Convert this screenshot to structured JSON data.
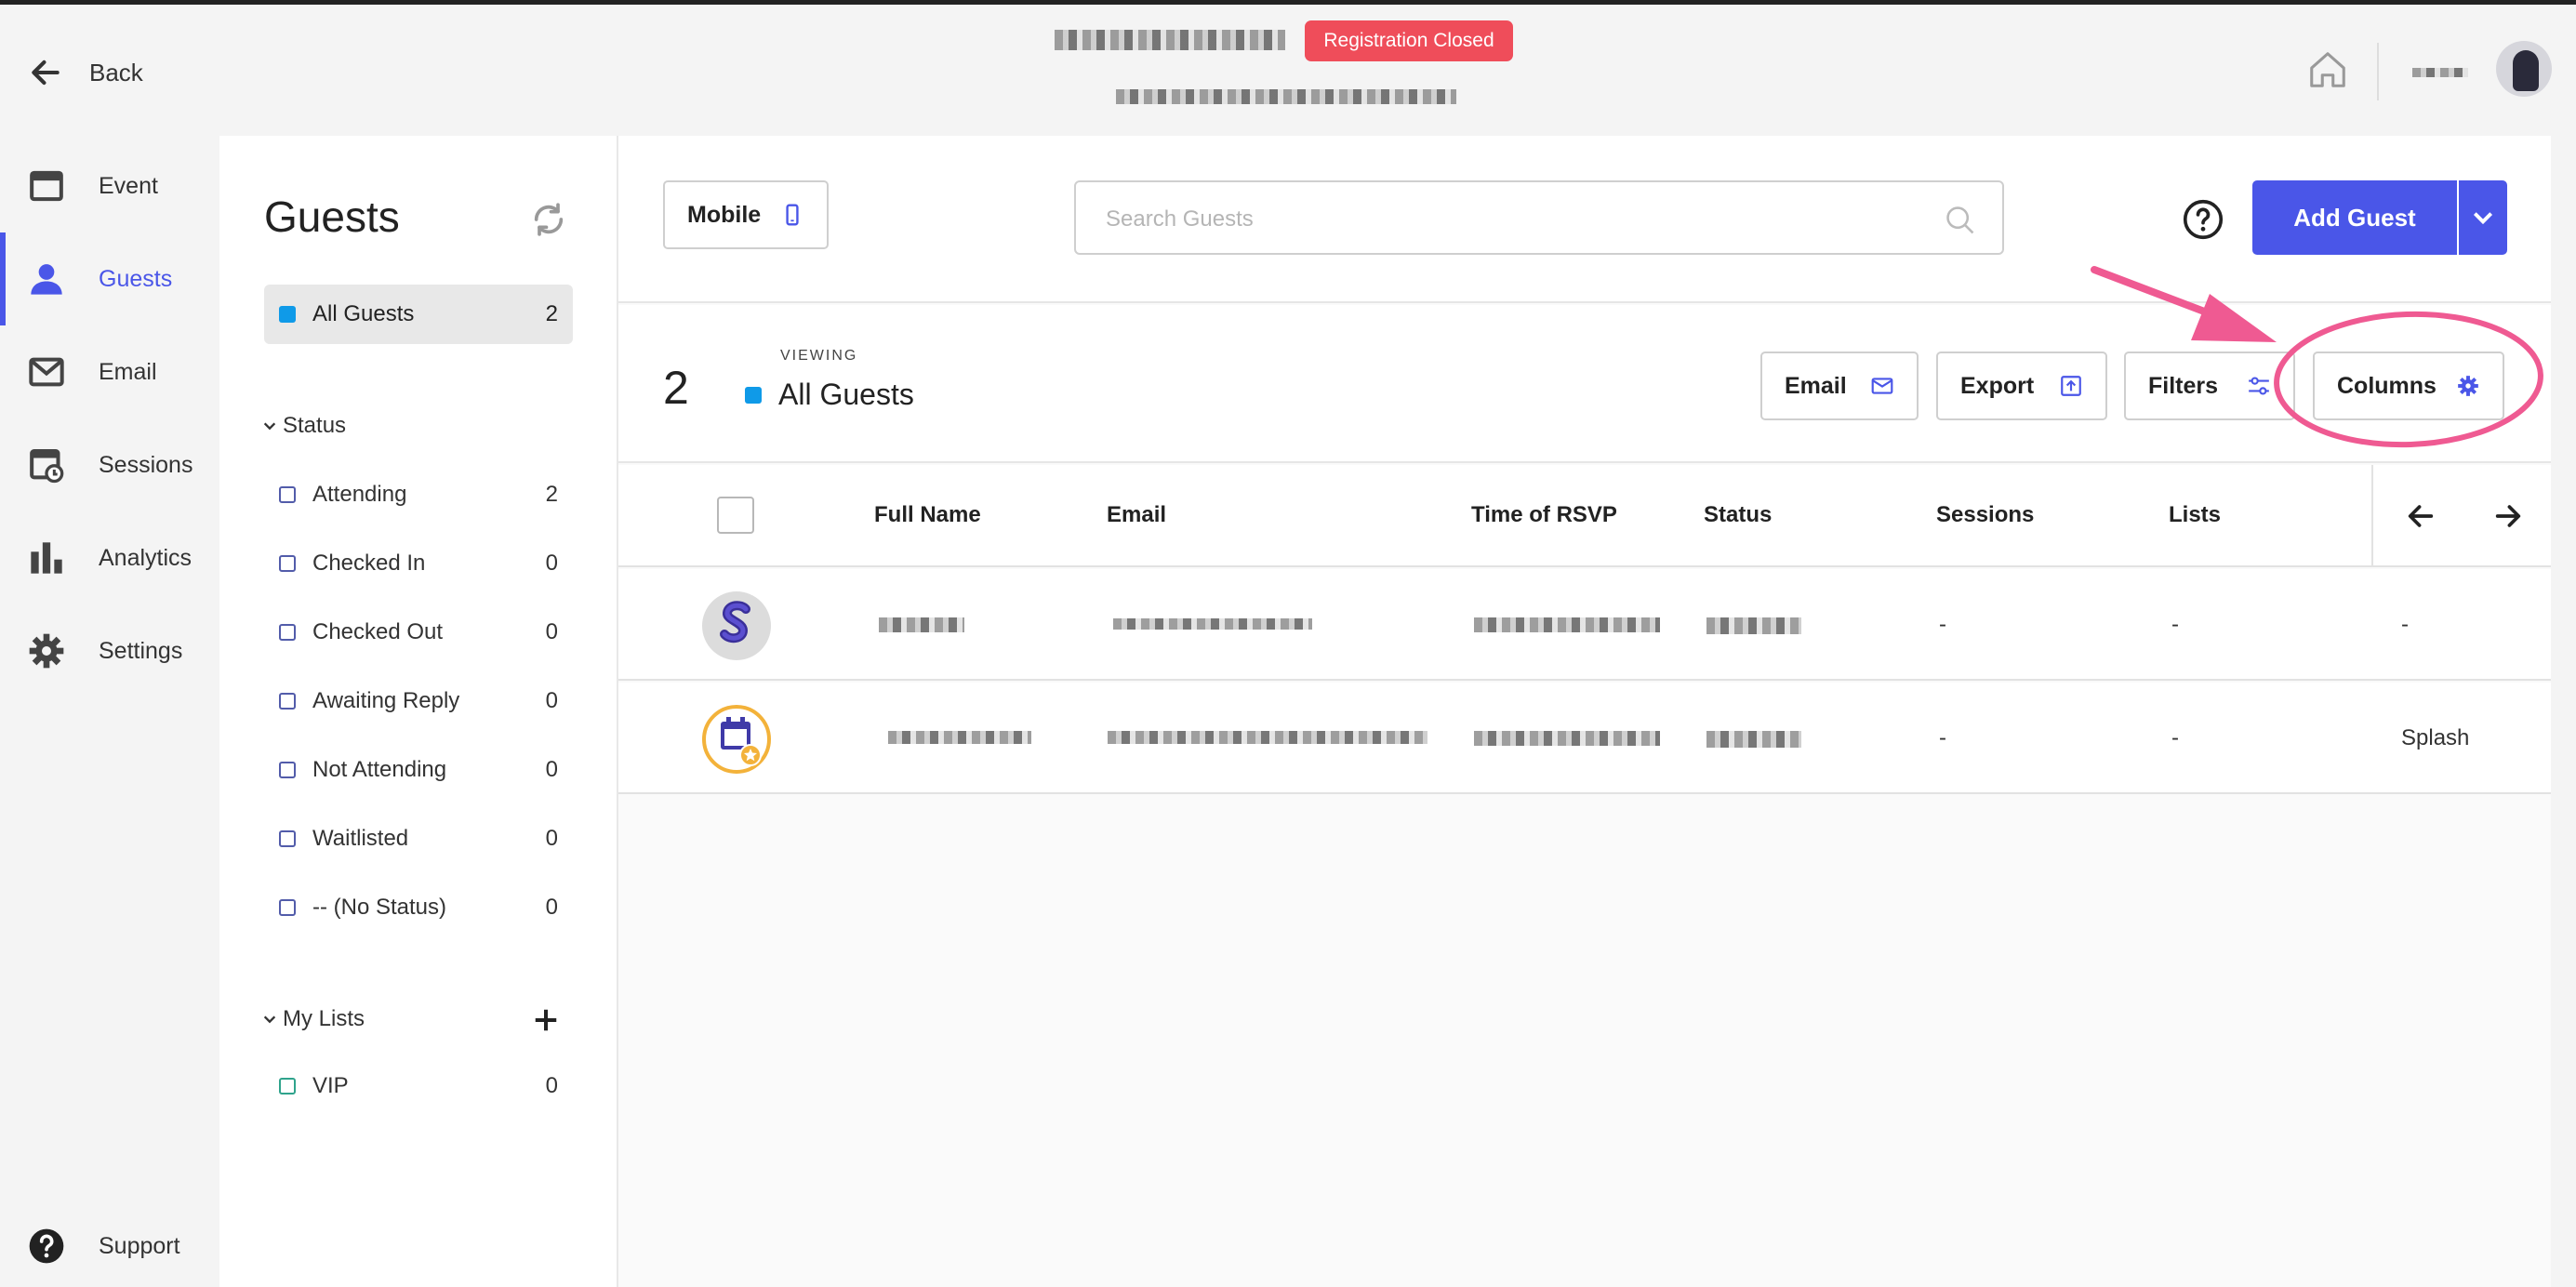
{
  "header": {
    "back_label": "Back",
    "badge": "Registration Closed"
  },
  "nav": {
    "items": [
      {
        "label": "Event",
        "icon": "calendar-icon"
      },
      {
        "label": "Guests",
        "icon": "person-icon"
      },
      {
        "label": "Email",
        "icon": "mail-icon"
      },
      {
        "label": "Sessions",
        "icon": "sessions-icon"
      },
      {
        "label": "Analytics",
        "icon": "bar-chart-icon"
      },
      {
        "label": "Settings",
        "icon": "gear-icon"
      }
    ],
    "active": "Guests",
    "support_label": "Support"
  },
  "guests_panel": {
    "title": "Guests",
    "all_guests": {
      "label": "All Guests",
      "count": "2"
    },
    "status_header": "Status",
    "statuses": [
      {
        "label": "Attending",
        "count": "2"
      },
      {
        "label": "Checked In",
        "count": "0"
      },
      {
        "label": "Checked Out",
        "count": "0"
      },
      {
        "label": "Awaiting Reply",
        "count": "0"
      },
      {
        "label": "Not Attending",
        "count": "0"
      },
      {
        "label": "Waitlisted",
        "count": "0"
      },
      {
        "label": "-- (No Status)",
        "count": "0"
      }
    ],
    "lists_header": "My Lists",
    "lists": [
      {
        "label": "VIP",
        "count": "0"
      }
    ]
  },
  "toolbar": {
    "mobile_label": "Mobile",
    "search_placeholder": "Search Guests",
    "add_guest_label": "Add Guest"
  },
  "view": {
    "count": "2",
    "viewing_label": "VIEWING",
    "name": "All Guests",
    "email_label": "Email",
    "export_label": "Export",
    "filters_label": "Filters",
    "columns_label": "Columns"
  },
  "table": {
    "columns": [
      "Full Name",
      "Email",
      "Time of RSVP",
      "Status",
      "Sessions",
      "Lists"
    ],
    "rows": [
      {
        "sessions": "-",
        "lists": "-",
        "extra": "-"
      },
      {
        "sessions": "-",
        "lists": "-",
        "extra": "Splash"
      }
    ]
  },
  "colors": {
    "accent": "#4a56e8",
    "badge_red": "#ef4d5a",
    "all_guests_blue": "#0f9ae8",
    "annotation_pink": "#ef5a92"
  }
}
